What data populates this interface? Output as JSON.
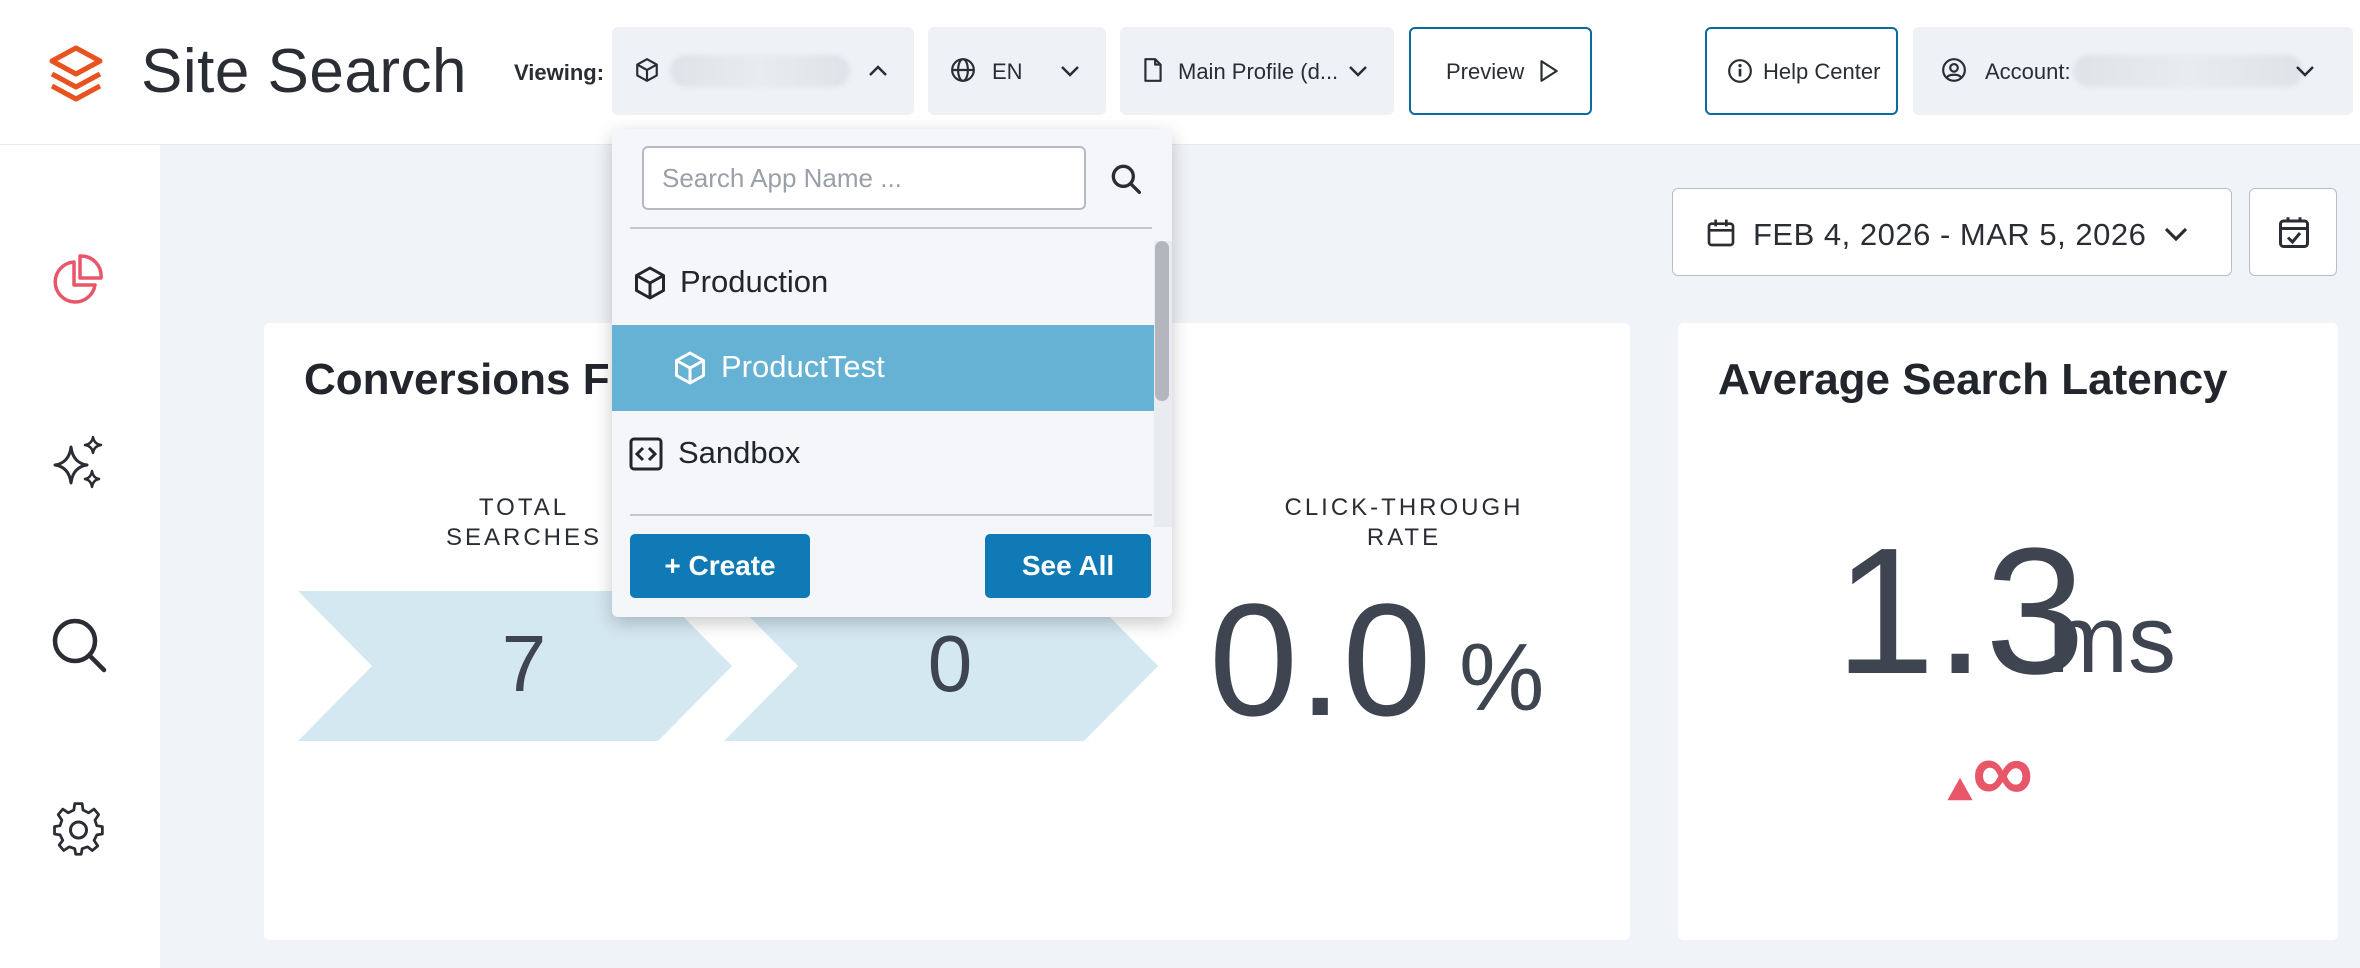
{
  "header": {
    "app_title": "Site Search",
    "viewing_label": "Viewing:",
    "language": "EN",
    "profile": "Main Profile (d...",
    "preview_label": "Preview",
    "help_label": "Help Center",
    "account_label": "Account:"
  },
  "app_dropdown": {
    "search_placeholder": "Search App Name ...",
    "items": [
      {
        "label": "Production",
        "icon": "cube-icon",
        "selected": false
      },
      {
        "label": "ProductTest",
        "icon": "cube-icon",
        "selected": true
      },
      {
        "label": "Sandbox",
        "icon": "code-box-icon",
        "selected": false
      }
    ],
    "create_label": "+ Create",
    "see_all_label": "See All"
  },
  "date_range": {
    "label": "FEB 4, 2026 - MAR 5, 2026"
  },
  "sidebar": {
    "items": [
      {
        "icon": "pie-chart-icon",
        "active": true
      },
      {
        "icon": "sparkles-icon",
        "active": false
      },
      {
        "icon": "search-icon",
        "active": false
      },
      {
        "icon": "gear-icon",
        "active": false
      }
    ]
  },
  "conversions_card": {
    "title": "Conversions Fr",
    "metrics": [
      {
        "label_line1": "TOTAL",
        "label_line2": "SEARCHES",
        "value": "7"
      },
      {
        "value": "0"
      },
      {
        "label_line1": "CLICK-THROUGH",
        "label_line2": "RATE",
        "value": "0.0",
        "unit": "%"
      }
    ]
  },
  "latency_card": {
    "title": "Average Search Latency",
    "value": "1.3",
    "unit": "ms",
    "change": "∞"
  },
  "colors": {
    "brand_orange": "#e8521f",
    "accent_blue": "#0f7ab5",
    "selected_row": "#66b2d4",
    "funnel_fill": "#d4e8f2",
    "change_red": "#e8566a",
    "active_icon": "#e8566a"
  }
}
